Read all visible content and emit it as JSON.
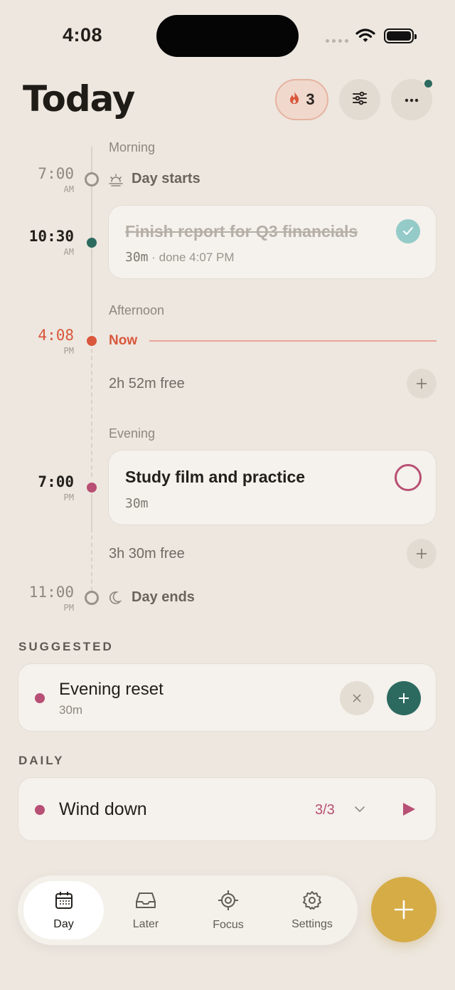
{
  "status_bar": {
    "time": "4:08"
  },
  "header": {
    "title": "Today",
    "streak_count": "3"
  },
  "timeline": {
    "sections": {
      "morning": "Morning",
      "afternoon": "Afternoon",
      "evening": "Evening"
    },
    "day_start": {
      "time": "7:00",
      "ampm": "AM",
      "label": "Day starts"
    },
    "task_done": {
      "time": "10:30",
      "ampm": "AM",
      "title": "Finish report for Q3 financials",
      "duration": "30m",
      "done_text": "· done 4:07 PM",
      "dot_color": "#2c6a60"
    },
    "now": {
      "time": "4:08",
      "ampm": "PM",
      "label": "Now",
      "color": "#d9573c"
    },
    "free_1": "2h 52m free",
    "task_open": {
      "time": "7:00",
      "ampm": "PM",
      "title": "Study film and practice",
      "duration": "30m",
      "dot_color": "#b84f74"
    },
    "free_2": "3h 30m free",
    "day_end": {
      "time": "11:00",
      "ampm": "PM",
      "label": "Day ends"
    }
  },
  "suggested": {
    "heading": "SUGGESTED",
    "item": {
      "title": "Evening reset",
      "duration": "30m",
      "color": "#b84f74"
    }
  },
  "daily": {
    "heading": "DAILY",
    "item": {
      "title": "Wind down",
      "progress": "3/3",
      "color": "#b84f74"
    }
  },
  "tabbar": {
    "tabs": [
      {
        "label": "Day",
        "icon": "calendar-icon",
        "active": true
      },
      {
        "label": "Later",
        "icon": "inbox-icon",
        "active": false
      },
      {
        "label": "Focus",
        "icon": "target-icon",
        "active": false
      },
      {
        "label": "Settings",
        "icon": "gear-icon",
        "active": false
      }
    ]
  },
  "colors": {
    "background": "#ede7df",
    "accent_green": "#2c6a60",
    "accent_pink": "#b84f74",
    "now_red": "#d9573c",
    "fab_gold": "#d6ac47"
  }
}
